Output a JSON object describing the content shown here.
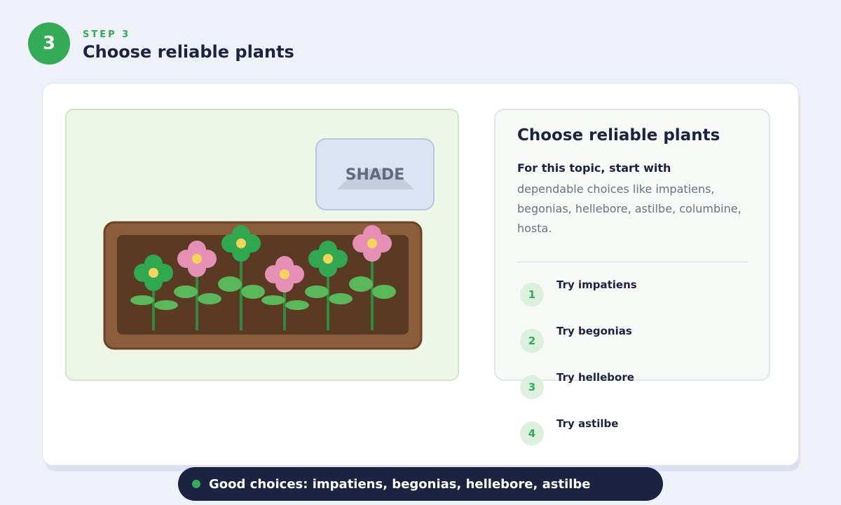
{
  "header": {
    "step_number": "3",
    "step_label": "STEP 3",
    "title": "Choose reliable plants"
  },
  "scene": {
    "shade_sign": "SHADE"
  },
  "info": {
    "title": "Choose reliable plants",
    "lead": "For this topic, start with",
    "description": "dependable choices like impatiens, begonias, hellebore, astilbe, columbine, hosta."
  },
  "tips": [
    {
      "number": "1",
      "label": "Try impatiens"
    },
    {
      "number": "2",
      "label": "Try begonias"
    },
    {
      "number": "3",
      "label": "Try hellebore"
    },
    {
      "number": "4",
      "label": "Try astilbe"
    }
  ],
  "summary": {
    "text": "Good choices: impatiens, begonias, hellebore, astilbe"
  },
  "colors": {
    "accent_green": "#34ab56",
    "navy": "#1c2340",
    "soil": "#5a3a22",
    "planter": "#8b5e3b",
    "flower_pink": "#e690b6",
    "flower_green": "#2fa84f"
  }
}
